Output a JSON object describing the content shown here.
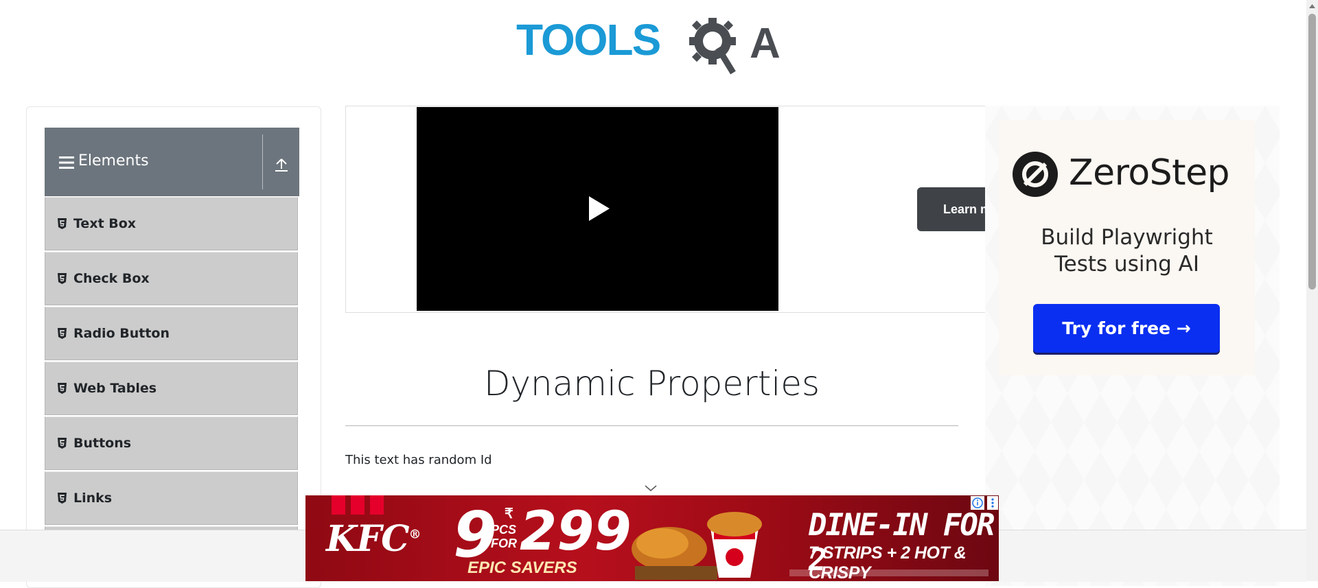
{
  "header": {
    "logo_text_a": "TOOLS",
    "logo_text_b": "A",
    "colors": {
      "tools_blue": "#1b9ad6",
      "qa_dark": "#4a4e53"
    }
  },
  "sidebar": {
    "group_title": "Elements",
    "items": [
      {
        "label": "Text Box"
      },
      {
        "label": "Check Box"
      },
      {
        "label": "Radio Button"
      },
      {
        "label": "Web Tables"
      },
      {
        "label": "Buttons"
      },
      {
        "label": "Links"
      }
    ]
  },
  "video_ad": {
    "learn_button_label": "Learn m"
  },
  "right_ad": {
    "brand": "ZeroStep",
    "tagline_line1": "Build Playwright",
    "tagline_line2": "Tests using AI",
    "cta_label": "Try for free →",
    "colors": {
      "cta_blue": "#0a2ff0"
    }
  },
  "main": {
    "title": "Dynamic Properties",
    "random_id_text": "This text has random Id"
  },
  "bottom_ad": {
    "brand": "KFC",
    "count": "9",
    "pcs_for": "PCS FOR",
    "currency": "₹",
    "price": "299",
    "subline": "EPIC SAVERS",
    "headline": "DINE-IN FOR 2",
    "offer": "7 STRIPS + 2 HOT & CRISPY"
  },
  "icons": [
    "hamburger-icon",
    "collapse-up-icon",
    "html5-icon",
    "play-icon",
    "zerostep-logo-icon",
    "chevron-down-icon",
    "ad-info-icon",
    "kebab-menu-icon"
  ]
}
